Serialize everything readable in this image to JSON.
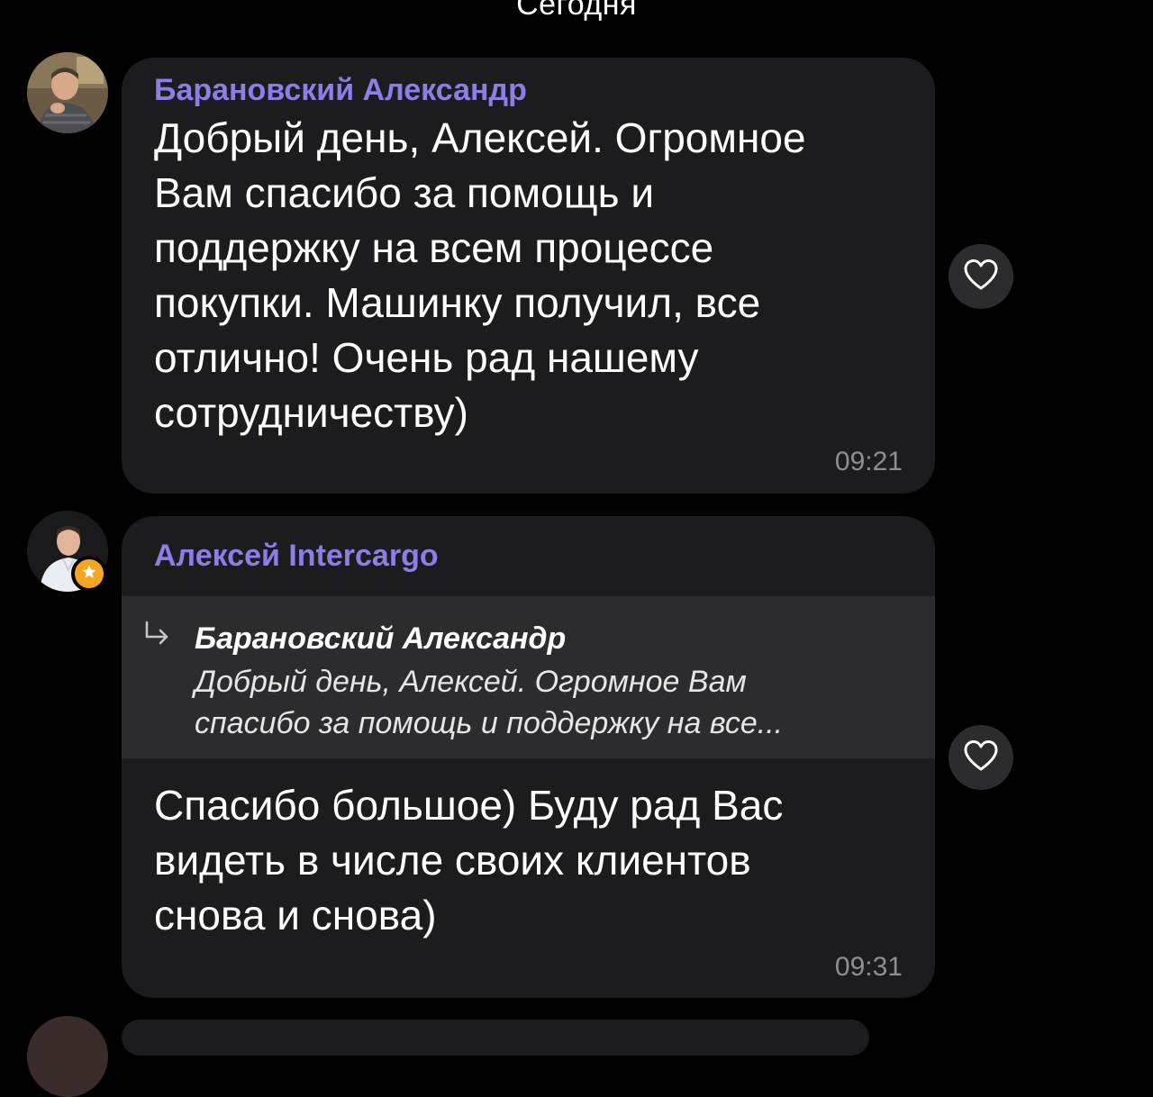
{
  "date_separator": "Сегодня",
  "messages": [
    {
      "sender": "Барановский Александр",
      "text": "Добрый день, Алексей. Огромное\nВам спасибо за помощь и\nподдержку на всем процессе\nпокупки. Машинку получил, все\nотлично! Очень рад нашему\nсотрудничеству)",
      "time": "09:21",
      "reaction_icon": "heart-outline-icon"
    },
    {
      "sender": "Алексей Intercargo",
      "is_admin": true,
      "reply": {
        "sender": "Барановский Александр",
        "text": "Добрый день, Алексей. Огромное Вам\nспасибо за помощь и поддержку на все..."
      },
      "text": "Спасибо большое) Буду рад Вас\nвидеть в числе своих клиентов\nснова и снова)",
      "time": "09:31",
      "reaction_icon": "heart-outline-icon"
    }
  ],
  "colors": {
    "background": "#000000",
    "bubble": "#1c1c1e",
    "reply_bg": "#2c2c2e",
    "sender_name": "#8c7ee8",
    "time": "#8e8e93",
    "admin_badge": "#f5a623"
  }
}
